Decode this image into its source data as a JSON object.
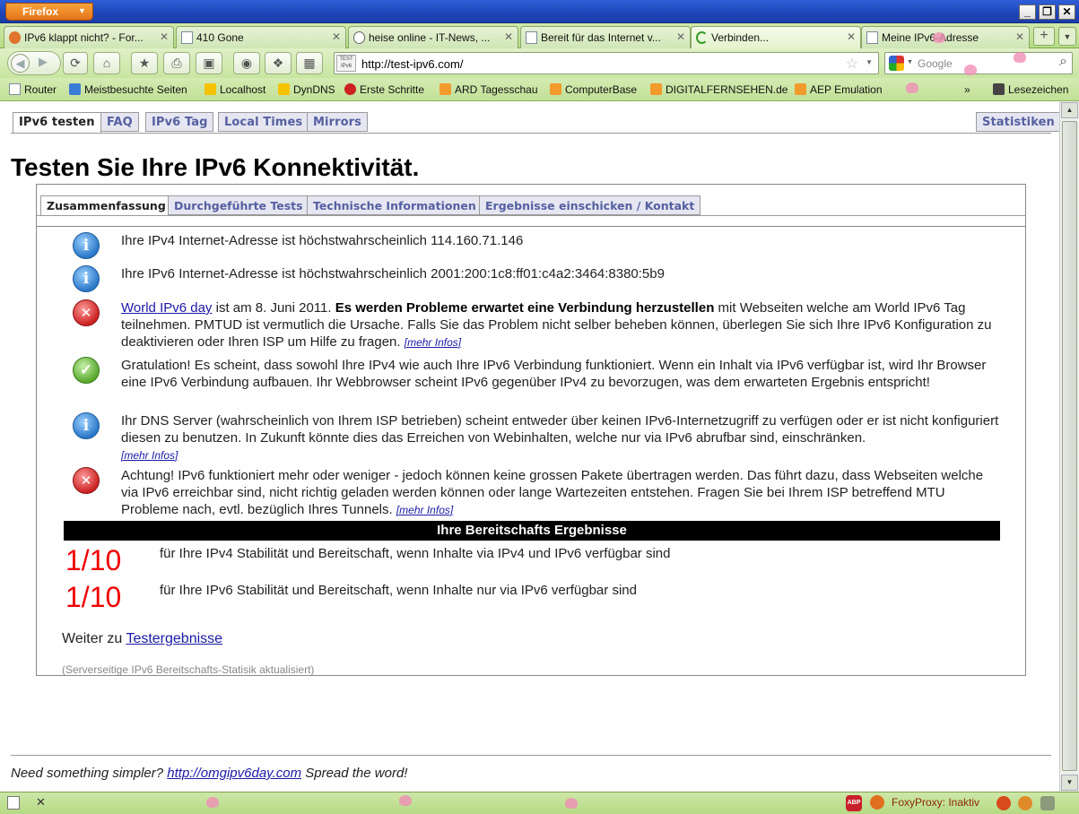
{
  "browser": {
    "menu_label": "Firefox",
    "window_controls": {
      "minimize": "_",
      "restore": "❐",
      "close": "✕"
    },
    "tabs": [
      {
        "label": "IPv6 klappt nicht? - For...",
        "icon": "forum-favicon",
        "active": false
      },
      {
        "label": "410 Gone",
        "icon": "page-icon",
        "active": false
      },
      {
        "label": "heise online - IT-News, ...",
        "icon": "heise-favicon",
        "active": false
      },
      {
        "label": "Bereit für das Internet v...",
        "icon": "page-icon",
        "active": false
      },
      {
        "label": "Verbinden...",
        "icon": "loading-icon",
        "active": true
      },
      {
        "label": "Meine IPv6-Adresse",
        "icon": "page-icon",
        "active": false
      }
    ],
    "new_tab": "+",
    "url": "http://test-ipv6.com/",
    "site_icon_text": "TEST IPv6",
    "search_engine": "Google",
    "search_placeholder": "Google",
    "bookmarks": [
      {
        "label": "Router",
        "icon": "page-icon"
      },
      {
        "label": "Meistbesuchte Seiten",
        "icon": "search-icon"
      },
      {
        "label": "Localhost",
        "icon": "pma-icon"
      },
      {
        "label": "DynDNS",
        "icon": "pma-icon"
      },
      {
        "label": "Erste Schritte",
        "icon": "red-icon"
      },
      {
        "label": "ARD Tagesschau",
        "icon": "rss-icon"
      },
      {
        "label": "ComputerBase",
        "icon": "rss-icon"
      },
      {
        "label": "DIGITALFERNSEHEN.de",
        "icon": "rss-icon"
      },
      {
        "label": "AEP Emulation",
        "icon": "rss-icon"
      }
    ],
    "bookmarks_overflow": "»",
    "bookmarks_menu": "Lesezeichen"
  },
  "page": {
    "nav_tabs": [
      "IPv6 testen",
      "FAQ",
      "IPv6 Tag",
      "Local Times",
      "Mirrors"
    ],
    "nav_right": "Statistiken",
    "title": "Testen Sie Ihre IPv6 Konnektivität.",
    "sub_tabs": [
      "Zusammenfassung",
      "Durchgeführte Tests",
      "Technische Informationen",
      "Ergebnisse einschicken / Kontakt"
    ],
    "messages": {
      "ipv4": {
        "icon": "info-icon",
        "text": "Ihre IPv4 Internet-Adresse ist höchstwahrscheinlich 114.160.71.146"
      },
      "ipv6": {
        "icon": "info-icon",
        "text": "Ihre IPv6 Internet-Adresse ist höchstwahrscheinlich 2001:200:1c8:ff01:c4a2:3464:8380:5b9"
      },
      "worldday": {
        "icon": "error-icon",
        "link": "World IPv6 day",
        "text1": " ist am 8. Juni 2011. ",
        "bold": "Es werden Probleme erwartet eine Verbindung herzustellen",
        "text2": " mit Webseiten welche am World IPv6 Tag teilnehmen. PMTUD ist vermutlich die Ursache. Falls Sie das Problem nicht selber beheben können, überlegen Sie sich Ihre IPv6 Konfiguration zu deaktivieren oder Ihren ISP um Hilfe zu fragen. ",
        "more": "[mehr Infos]"
      },
      "congrats": {
        "icon": "check-icon",
        "text": "Gratulation! Es scheint, dass sowohl Ihre IPv4 wie auch Ihre IPv6 Verbindung funktioniert. Wenn ein Inhalt via IPv6 verfügbar ist, wird Ihr Browser eine IPv6 Verbindung aufbauen. Ihr Webbrowser scheint IPv6 gegenüber IPv4 zu bevorzugen, was dem erwarteten Ergebnis entspricht!"
      },
      "dns": {
        "icon": "info-icon",
        "text": "Ihr DNS Server (wahrscheinlich von Ihrem ISP betrieben) scheint entweder über keinen IPv6-Internetzugriff zu verfügen oder er ist nicht konfiguriert diesen zu benutzen. In Zukunft könnte dies das Erreichen von Webinhalten, welche nur via IPv6 abrufbar sind, einschränken.",
        "more": "[mehr Infos]"
      },
      "mtu": {
        "icon": "error-icon",
        "text": "Achtung! IPv6 funktioniert mehr oder weniger - jedoch können keine grossen Pakete übertragen werden. Das führt dazu, dass Webseiten welche via IPv6 erreichbar sind, nicht richtig geladen werden können oder lange Wartezeiten entstehen. Fragen Sie bei Ihrem ISP betreffend MTU Probleme nach, evtl. bezüglich Ihres Tunnels. ",
        "more": "[mehr Infos]"
      }
    },
    "results_header": "Ihre Bereitschafts Ergebnisse",
    "scores": [
      {
        "score": "1/10",
        "desc": "für Ihre IPv4 Stabilität und Bereitschaft, wenn Inhalte via IPv4 und IPv6 verfügbar sind"
      },
      {
        "score": "1/10",
        "desc": "für Ihre IPv6 Stabilität und Bereitschaft, wenn Inhalte nur via IPv6 verfügbar sind"
      }
    ],
    "continue_prefix": "Weiter zu ",
    "continue_link": "Testergebnisse",
    "updated_note": "(Serverseitige IPv6 Bereitschafts-Statisik aktualisiert)",
    "footer": {
      "prefix": "Need something simpler? ",
      "link": "http://omgipv6day.com",
      "suffix": " Spread the word!"
    }
  },
  "statusbar": {
    "close_symbol": "✕",
    "adblock": "ABP",
    "foxyproxy": "FoxyProxy: Inaktiv"
  },
  "colors": {
    "chrome_green": "#c8e5a1",
    "titlebar_blue": "#1d44b8",
    "score_red": "#ee0000",
    "results_bar": "#000000",
    "tab_text": "#5560a0"
  }
}
